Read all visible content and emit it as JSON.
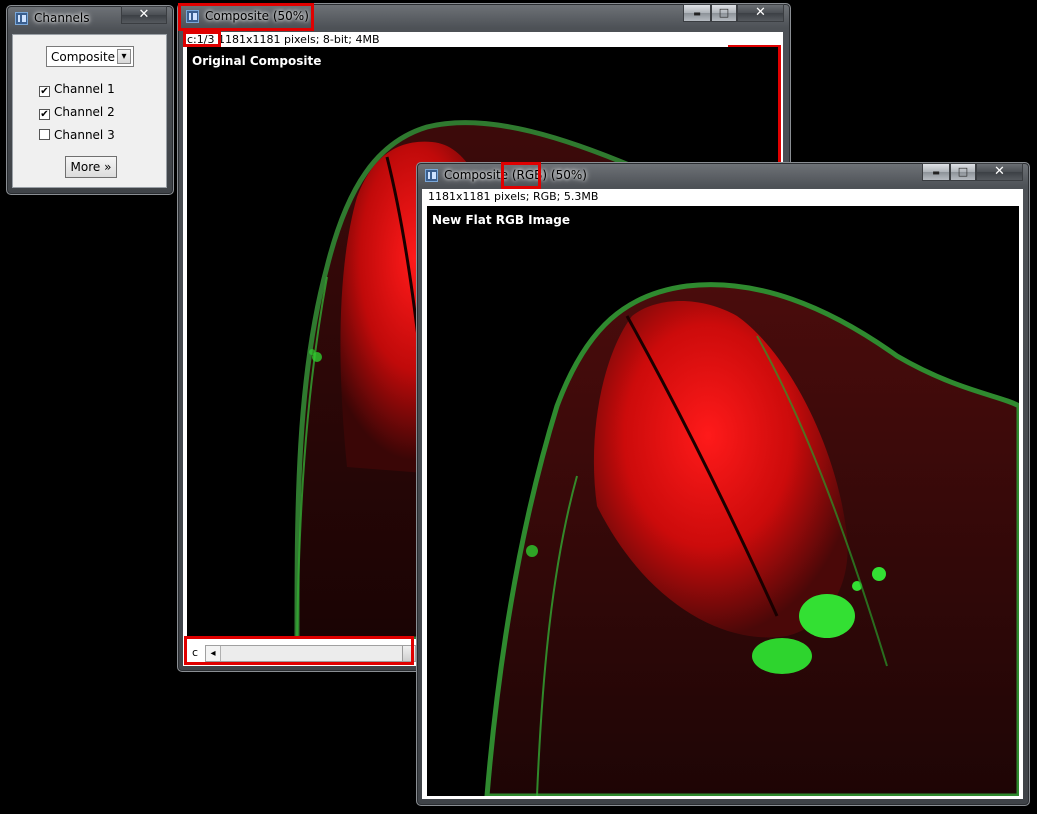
{
  "channels_window": {
    "title": "Channels",
    "close_glyph": "✕",
    "mode_select": {
      "value": "Composite",
      "arrow": "▾"
    },
    "channels": [
      {
        "label": "Channel 1",
        "checked": true
      },
      {
        "label": "Channel 2",
        "checked": true
      },
      {
        "label": "Channel 3",
        "checked": false
      }
    ],
    "more_button": "More »"
  },
  "composite_window": {
    "title": "Composite (50%)",
    "min_glyph": "▬",
    "max_glyph": "□",
    "close_glyph": "✕",
    "info_channel": "c:1/3",
    "info_rest": " 1181x1181 pixels; 8-bit; 4MB",
    "image_label": "Original Composite",
    "slider_label": "c",
    "slider_left_arrow": "◂"
  },
  "rgb_window": {
    "title_before": "Composite ",
    "title_highlight": "(RGB)",
    "title_after": " (50%)",
    "min_glyph": "▬",
    "max_glyph": "□",
    "close_glyph": "✕",
    "info": "1181x1181 pixels; RGB; 5.3MB",
    "image_label": "New Flat RGB Image"
  },
  "colors": {
    "highlight": "#e00000",
    "channel1": "#ff1a1a",
    "channel2": "#22dd22"
  },
  "icons": [
    "imagej-icon",
    "close-icon",
    "minimize-icon",
    "maximize-icon",
    "dropdown-arrow-icon",
    "checkbox-icon",
    "scroll-left-arrow-icon"
  ]
}
